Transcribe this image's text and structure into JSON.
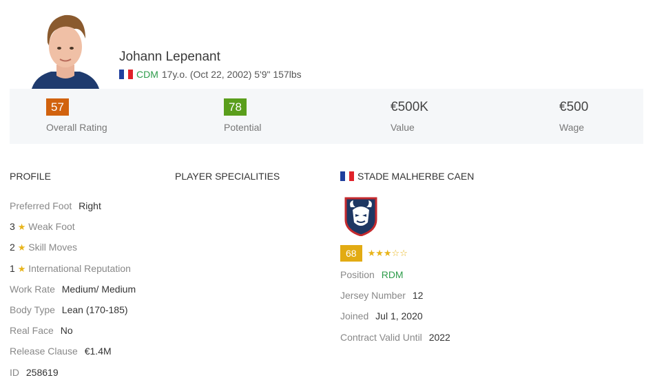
{
  "player": {
    "name": "Johann Lepenant",
    "position": "CDM",
    "details": "17y.o. (Oct 22, 2002) 5'9\" 157lbs",
    "flag": "france-flag"
  },
  "stats": [
    {
      "value": "57",
      "label": "Overall Rating",
      "style": "badge",
      "color": "#d1620e"
    },
    {
      "value": "78",
      "label": "Potential",
      "style": "badge",
      "color": "#5a9e1c"
    },
    {
      "value": "€500K",
      "label": "Value",
      "style": "plain"
    },
    {
      "value": "€500",
      "label": "Wage",
      "style": "plain"
    }
  ],
  "sections": {
    "profile": "PROFILE",
    "specialities": "PLAYER SPECIALITIES",
    "club": "STADE MALHERBE CAEN"
  },
  "profile": {
    "preferred_foot": {
      "label": "Preferred Foot",
      "value": "Right"
    },
    "weak_foot": {
      "num": "3",
      "label": "Weak Foot"
    },
    "skill_moves": {
      "num": "2",
      "label": "Skill Moves"
    },
    "intl_rep": {
      "num": "1",
      "label": "International Reputation"
    },
    "work_rate": {
      "label": "Work Rate",
      "value": "Medium/ Medium"
    },
    "body_type": {
      "label": "Body Type",
      "value": "Lean (170-185)"
    },
    "real_face": {
      "label": "Real Face",
      "value": "No"
    },
    "release_clause": {
      "label": "Release Clause",
      "value": "€1.4M"
    },
    "id": {
      "label": "ID",
      "value": "258619"
    }
  },
  "club": {
    "rating": "68",
    "stars_filled": 3,
    "stars_total": 5,
    "position": {
      "label": "Position",
      "value": "RDM"
    },
    "jersey": {
      "label": "Jersey Number",
      "value": "12"
    },
    "joined": {
      "label": "Joined",
      "value": "Jul 1, 2020"
    },
    "contract": {
      "label": "Contract Valid Until",
      "value": "2022"
    }
  },
  "icons": {
    "star": "★",
    "star_empty": "☆"
  },
  "colors": {
    "overall": "#d1620e",
    "potential": "#5a9e1c",
    "club_rating": "#e2ab13",
    "star": "#e8b41a",
    "link_green": "#2e9c4b"
  }
}
